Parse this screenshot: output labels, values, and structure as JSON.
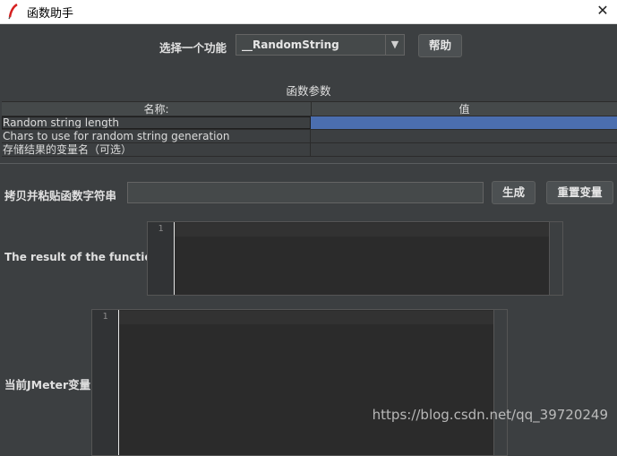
{
  "window": {
    "title": "函数助手",
    "close_glyph": "✕",
    "app_icon": "feather-icon"
  },
  "function_select": {
    "label": "选择一个功能",
    "value": "__RandomString",
    "arrow_glyph": "▼"
  },
  "help_button": {
    "label": "帮助"
  },
  "params": {
    "section_title": "函数参数",
    "col_name": "名称:",
    "col_value": "值",
    "rows": [
      {
        "name": "Random string length",
        "value": "",
        "selected": true
      },
      {
        "name": "Chars to use for random string generation",
        "value": "",
        "selected": false
      },
      {
        "name": "存储结果的变量名（可选）",
        "value": "",
        "selected": false
      }
    ]
  },
  "copy_paste": {
    "label": "拷贝并粘贴函数字符串",
    "value": "",
    "generate_label": "生成",
    "reset_label": "重置变量"
  },
  "result": {
    "label": "The result of the function is",
    "line_number": "1"
  },
  "jmeter_vars": {
    "label": "当前JMeter变量",
    "line_number": "1"
  },
  "watermark": "https://blog.csdn.net/qq_39720249",
  "colors": {
    "background": "#3c3f41",
    "selection": "#4b6eaf",
    "editor_bg": "#2b2b2b"
  }
}
